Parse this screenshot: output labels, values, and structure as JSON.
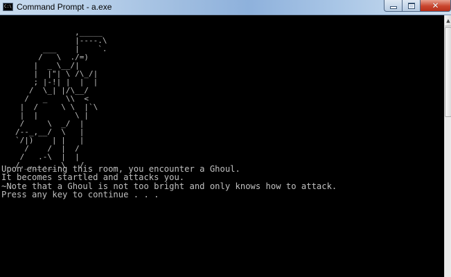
{
  "window": {
    "title": "Command Prompt - a.exe",
    "icon_text": "C:\\",
    "controls": {
      "minimize": "minimize-icon",
      "maximize": "maximize-icon",
      "close": "close-icon",
      "close_glyph": "✕"
    }
  },
  "console": {
    "ascii_art": "             ,_____\n             |----.\\\n      ___    |    `.\n     /   \\  ./=)\n    |  _ \\__/|\n    |  |\"| \\ /\\_/|\n    ; |-!| |  |  |\n   /  \\_| |/\\__/\n  /   _    \\\\  <\n |  /     \\ \\  |`\\\n |  |        \\ |\n /     \\  _/  |\n/--_,__/  \\   |\n`/|)    | |   |\n  /    /  |  /\n /   .-\\  |  |\n/,_.__.__.\\   /\n",
    "lines": [
      "Upon entering this room, you encounter a Ghoul.",
      "It becomes startled and attacks you.",
      "~Note that a Ghoul is not too bright and only knows how to attack.",
      "Press any key to continue . . ."
    ]
  },
  "colors": {
    "console_bg": "#000000",
    "console_fg": "#c0c0c0",
    "close_button": "#c9452e"
  },
  "scrollbar": {
    "up_arrow": "▲"
  }
}
